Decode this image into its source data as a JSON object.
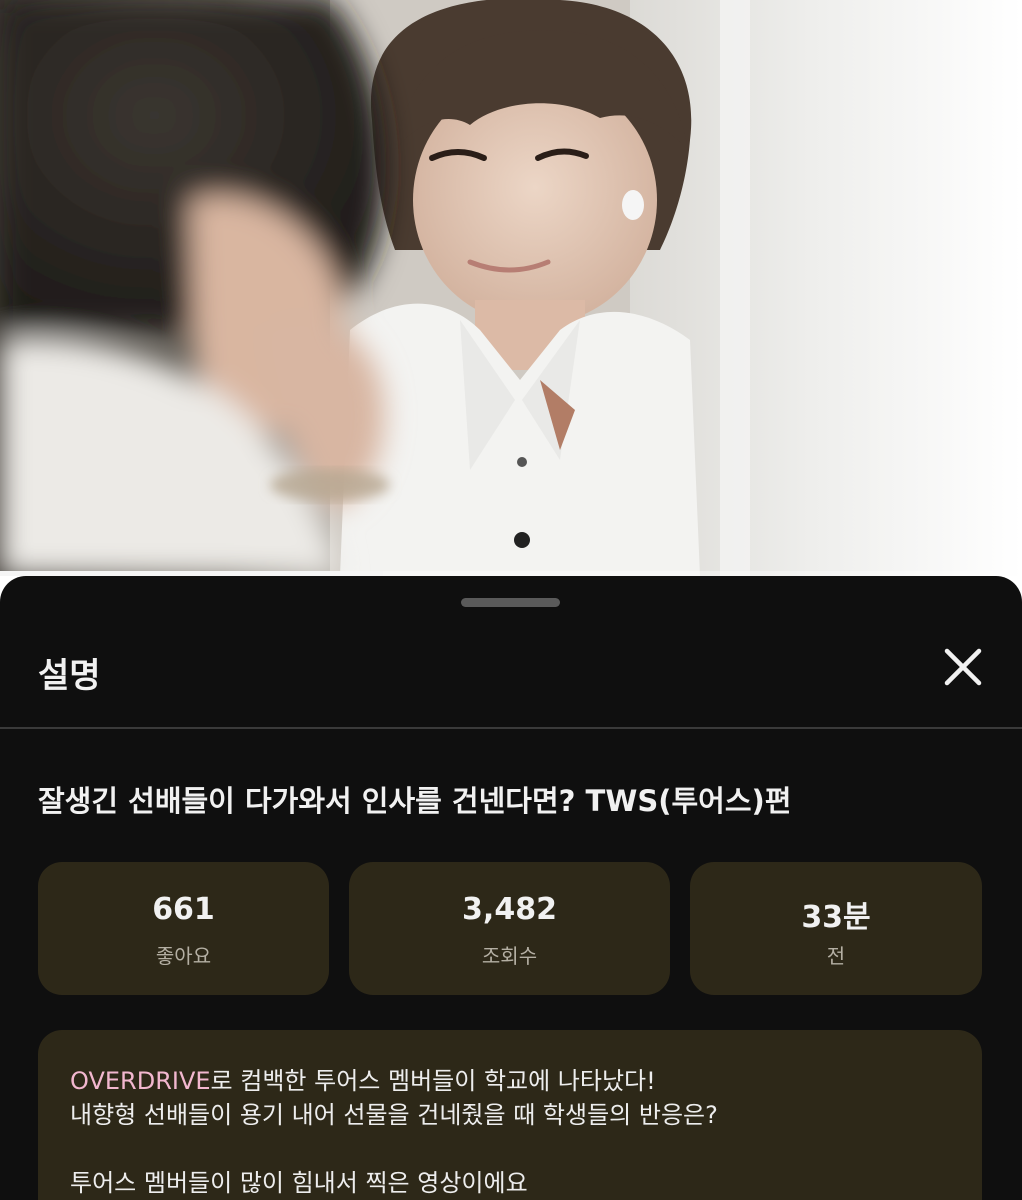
{
  "video": {
    "progress_fraction": 0.375
  },
  "sheet": {
    "title": "설명",
    "close_icon": "close-icon",
    "video_title": "잘생긴 선배들이 다가와서 인사를 건넨다면? TWS(투어스)편",
    "stats": [
      {
        "value": "661",
        "label": "좋아요"
      },
      {
        "value": "3,482",
        "label": "조회수"
      },
      {
        "value": "33분",
        "label": "전"
      }
    ],
    "description": {
      "line1_link": "OVERDRIVE",
      "line1_rest": "로 컴백한 투어스 멤버들이 학교에 나타났다!",
      "line2": "내향형 선배들이 용기 내어 선물을 건네줬을 때 학생들의 반응은?",
      "line3": "투어스 멤버들이 많이 힘내서 찍은 영상이에요"
    },
    "colors": {
      "sheet_background": "#0f0f0f",
      "card_background": "#2d2818",
      "link_color": "#f2b7cf"
    }
  }
}
